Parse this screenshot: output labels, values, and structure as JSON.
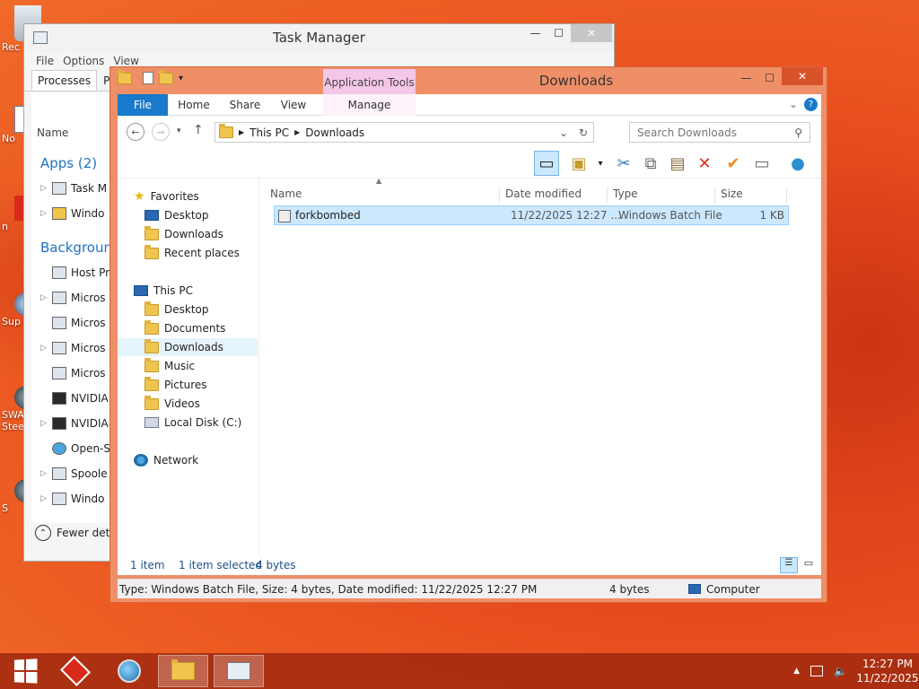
{
  "desktop": {
    "icons": [
      {
        "label": "Rec",
        "icon": "recycle-bin-icon"
      },
      {
        "label": "No",
        "icon": "notepad-icon"
      },
      {
        "label": "n",
        "icon": "app-icon"
      },
      {
        "label": "Sup",
        "icon": "support-icon"
      },
      {
        "label": "SWA Stee",
        "icon": "steam-icon"
      },
      {
        "label": "S",
        "icon": "steam-icon"
      }
    ]
  },
  "task_manager": {
    "title": "Task Manager",
    "menu": [
      "File",
      "Options",
      "View"
    ],
    "tabs": [
      "Processes",
      "Per"
    ],
    "column_name": "Name",
    "group_apps": "Apps (2)",
    "group_background": "Backgroun",
    "apps": [
      "Task M",
      "Windo"
    ],
    "background": [
      "Host Pr",
      "Micros",
      "Micros",
      "Micros",
      "Micros",
      "NVIDIA",
      "NVIDIA",
      "Open-S",
      "Spoole",
      "Windo"
    ],
    "fewer_details": "Fewer deta"
  },
  "explorer": {
    "title": "Downloads",
    "application_tools": "Application Tools",
    "ribbon_tabs": {
      "file": "File",
      "home": "Home",
      "share": "Share",
      "view": "View",
      "manage": "Manage"
    },
    "address": {
      "root": "This PC",
      "current": "Downloads"
    },
    "search_placeholder": "Search Downloads",
    "nav": {
      "favorites": "Favorites",
      "fav_desktop": "Desktop",
      "fav_downloads": "Downloads",
      "fav_recent": "Recent places",
      "this_pc": "This PC",
      "pc_desktop": "Desktop",
      "pc_documents": "Documents",
      "pc_downloads": "Downloads",
      "pc_music": "Music",
      "pc_pictures": "Pictures",
      "pc_videos": "Videos",
      "pc_local_disk": "Local Disk (C:)",
      "network": "Network"
    },
    "columns": {
      "name": "Name",
      "date_modified": "Date modified",
      "type": "Type",
      "size": "Size"
    },
    "files": [
      {
        "name": "forkbombed",
        "date": "11/22/2025 12:27 ...",
        "type": "Windows Batch File",
        "size": "1 KB"
      }
    ],
    "status": {
      "count": "1 item",
      "selected": "1 item selected",
      "selected_size": "4 bytes"
    },
    "infobar": {
      "details": "Type: Windows Batch File, Size: 4 bytes, Date modified: 11/22/2025 12:27 PM",
      "size": "4 bytes",
      "location": "Computer"
    }
  },
  "taskbar": {
    "clock_time": "12:27 PM",
    "clock_date": "11/22/2025"
  },
  "colors": {
    "accent": "#1979ca",
    "selection": "#cce8ff",
    "explorer_frame": "#ef8f67"
  }
}
